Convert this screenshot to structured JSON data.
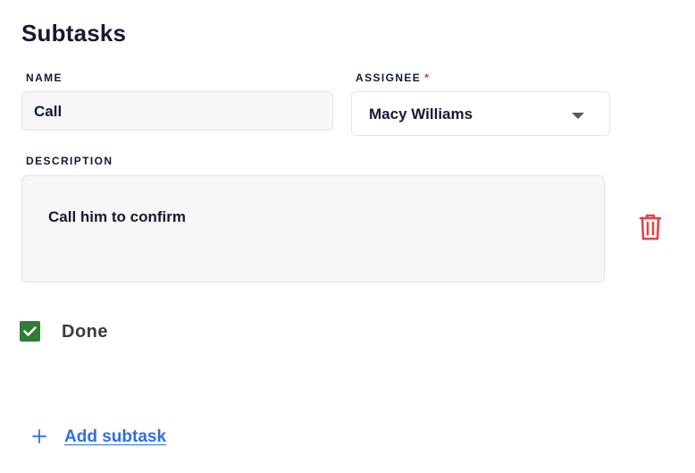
{
  "section": {
    "title": "Subtasks"
  },
  "subtask": {
    "name_label": "NAME",
    "name_value": "Call",
    "assignee_label": "ASSIGNEE",
    "assignee_required_marker": "*",
    "assignee_value": "Macy Williams",
    "description_label": "DESCRIPTION",
    "description_value": "Call him to confirm",
    "done_label": "Done",
    "done_checked": true,
    "delete_icon": "trash-icon"
  },
  "actions": {
    "add_icon": "plus-icon",
    "add_label": "Add subtask"
  },
  "colors": {
    "checkbox": "#2e7d32",
    "delete": "#e0454b",
    "link": "#2f6fe4",
    "required": "#e0303a"
  }
}
